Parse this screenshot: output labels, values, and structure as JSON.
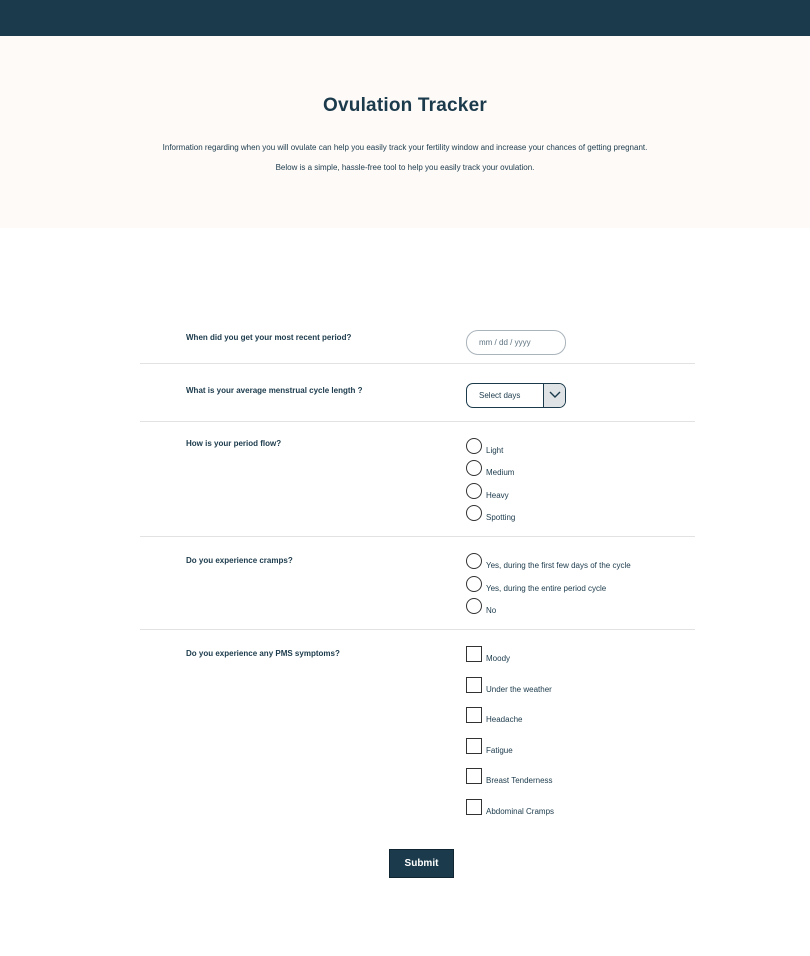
{
  "header": {
    "bar": ""
  },
  "hero": {
    "title": "Ovulation Tracker",
    "description_1": "Information regarding when you will ovulate can help you easily track your fertility window and increase your chances of getting pregnant.",
    "description_2": "Below is a simple, hassle-free tool to help you easily track your ovulation."
  },
  "form": {
    "q_period_date": "When did you get your most recent period?",
    "date_placeholder": "mm / dd / yyyy",
    "q_cycle_length": "What is your average menstrual cycle length ?",
    "cycle_select_value": "Select days",
    "q_flow": "How is your period flow?",
    "flow_options": [
      "Light",
      "Medium",
      "Heavy",
      "Spotting"
    ],
    "q_cramps": "Do you experience cramps?",
    "cramps_options": [
      "Yes, during the first few days of the cycle",
      "Yes, during the entire period cycle",
      "No"
    ],
    "q_pms": "Do you experience any PMS symptoms?",
    "pms_options": [
      "Moody",
      "Under the weather",
      "Headache",
      "Fatigue",
      "Breast Tenderness",
      "Abdominal Cramps"
    ],
    "submit_label": "Submit"
  },
  "colors": {
    "primary": "#1b3a4b",
    "hero_bg": "#fefaf8",
    "divider": "#e2e2e2"
  },
  "icons": {
    "select_arrow": "chevron-down-icon"
  }
}
